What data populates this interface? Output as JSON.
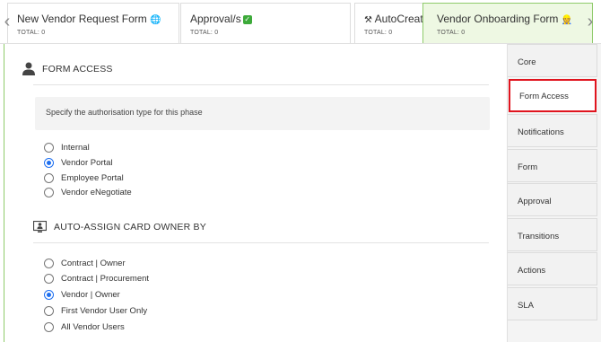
{
  "phases": [
    {
      "name": "New Vendor Request Form",
      "emoji": "🌐",
      "total": "TOTAL: 0"
    },
    {
      "name": "Approval/s",
      "badge": "✓",
      "total": "TOTAL: 0"
    },
    {
      "name": "AutoCreate V",
      "emoji": "⚒",
      "total": "TOTAL: 0"
    },
    {
      "name": "Vendor Onboarding Form",
      "emoji": "👷",
      "total": "TOTAL: 0"
    }
  ],
  "form_access": {
    "title": "FORM ACCESS",
    "info": "Specify the authorisation type for this phase",
    "options": [
      {
        "label": "Internal",
        "checked": false
      },
      {
        "label": "Vendor Portal",
        "checked": true
      },
      {
        "label": "Employee Portal",
        "checked": false
      },
      {
        "label": "Vendor eNegotiate",
        "checked": false
      }
    ]
  },
  "auto_assign": {
    "title": "AUTO-ASSIGN CARD OWNER BY",
    "options": [
      {
        "label": "Contract | Owner",
        "checked": false
      },
      {
        "label": "Contract | Procurement",
        "checked": false
      },
      {
        "label": "Vendor | Owner",
        "checked": true
      },
      {
        "label": "First Vendor User Only",
        "checked": false
      },
      {
        "label": "All Vendor Users",
        "checked": false
      }
    ]
  },
  "side_menu": {
    "items": [
      "Core",
      "Form Access",
      "Notifications",
      "Form",
      "Approval",
      "Transitions",
      "Actions",
      "SLA"
    ],
    "active": "Form Access"
  },
  "colors": {
    "active_phase_bg": "#eef8e3",
    "active_phase_border": "#8fcb6b",
    "radio_selected": "#1e6ff0",
    "highlight_border": "#e0141e",
    "check_badge": "#3daa3a"
  },
  "icons": {
    "prev": "chevron-left-icon",
    "next": "chevron-right-icon",
    "form_access": "user-icon",
    "auto_assign": "monitor-user-icon"
  }
}
